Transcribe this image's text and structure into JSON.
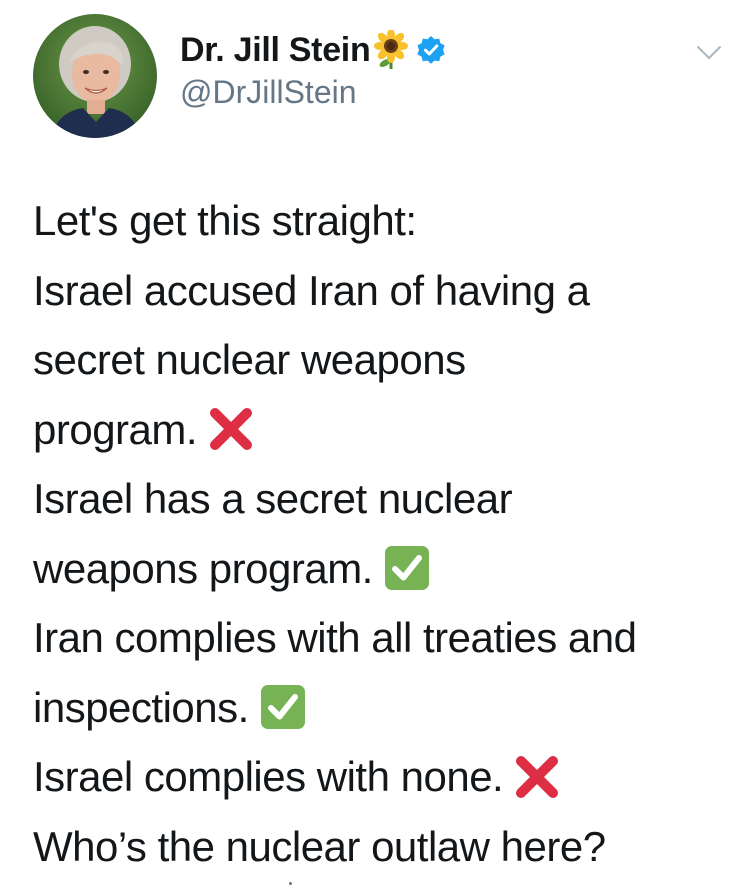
{
  "tweet": {
    "author": {
      "display_name": "Dr. Jill Stein",
      "handle": "@DrJillStein",
      "name_emoji": "sunflower-icon",
      "verified": true
    },
    "lines": [
      {
        "text": "Let's get this straight:",
        "mark": null
      },
      {
        "text": "Israel accused Iran of having a",
        "mark": null
      },
      {
        "text": "secret nuclear weapons",
        "mark": null
      },
      {
        "text": "program.",
        "mark": "red-cross-icon"
      },
      {
        "text": "Israel has a secret nuclear",
        "mark": null
      },
      {
        "text": "weapons program.",
        "mark": "green-check-icon"
      },
      {
        "text": "Iran complies with all treaties and",
        "mark": null
      },
      {
        "text": "inspections.",
        "mark": "green-check-icon"
      },
      {
        "text": "Israel complies with none.",
        "mark": "red-cross-icon"
      },
      {
        "text": "Who’s the nuclear outlaw here?",
        "mark": null
      }
    ]
  },
  "colors": {
    "text": "#14171a",
    "secondary": "#657786",
    "verified_blue": "#1da1f2",
    "cross_red": "#dd2e44",
    "check_green": "#77b255"
  }
}
